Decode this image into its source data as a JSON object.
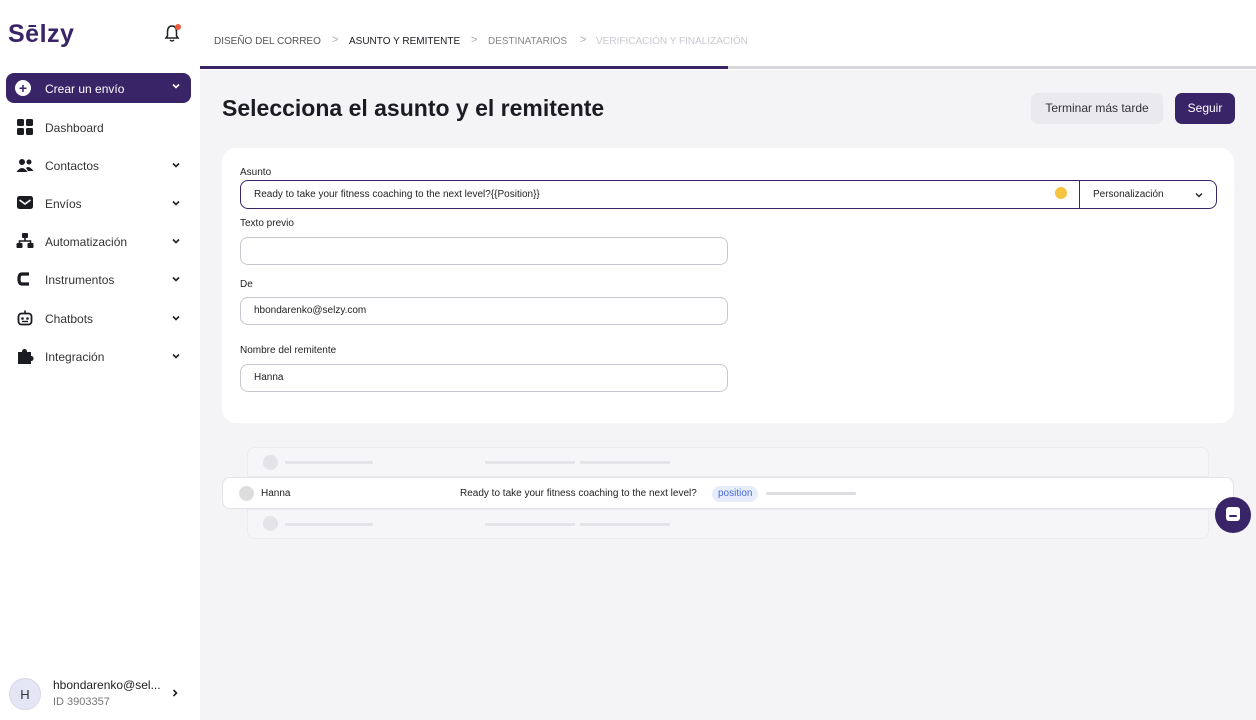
{
  "app": {
    "logo": "Sēlzy",
    "colors": {
      "brand": "#3a2468",
      "bell_dot": "#ef5a3c",
      "pill_bg": "#e6ecfb",
      "pill_text": "#4a6ad8"
    }
  },
  "sidebar": {
    "create_label": "Crear un envío",
    "items": [
      {
        "label": "Dashboard",
        "icon": "grid-icon",
        "has_chevron": false
      },
      {
        "label": "Contactos",
        "icon": "contacts-icon",
        "has_chevron": true
      },
      {
        "label": "Envíos",
        "icon": "mail-icon",
        "has_chevron": true
      },
      {
        "label": "Automatización",
        "icon": "hierarchy-icon",
        "has_chevron": true
      },
      {
        "label": "Instrumentos",
        "icon": "tools-icon",
        "has_chevron": true
      },
      {
        "label": "Chatbots",
        "icon": "robot-icon",
        "has_chevron": true
      },
      {
        "label": "Integración",
        "icon": "puzzle-icon",
        "has_chevron": true
      }
    ],
    "user": {
      "initial": "H",
      "name": "hbondarenko@sel...",
      "id": "ID 3903357"
    }
  },
  "breadcrumb": {
    "steps": [
      {
        "label": "DISEÑO DEL CORREO",
        "state": "done"
      },
      {
        "label": "ASUNTO Y REMITENTE",
        "state": "active"
      },
      {
        "label": "DESTINATARIOS",
        "state": "pending"
      },
      {
        "label": "VERIFICACIÓN Y FINALIZACIÓN",
        "state": "future"
      }
    ],
    "progress_fraction": 0.5
  },
  "header": {
    "title": "Selecciona el asunto y el remitente",
    "finish_later_label": "Terminar más tarde",
    "next_label": "Seguir"
  },
  "form": {
    "subject_label": "Asunto",
    "subject_value": "Ready to take your fitness coaching to the next level?{{Position}}",
    "personalization_label": "Personalización",
    "preheader_label": "Texto previo",
    "preheader_value": "",
    "from_label": "De",
    "from_value": "hbondarenko@selzy.com",
    "sender_name_label": "Nombre del remitente",
    "sender_name_value": "Hanna"
  },
  "preview": {
    "sender": "Hanna",
    "subject": "Ready to take your fitness coaching to the next level?",
    "tag": "position"
  }
}
